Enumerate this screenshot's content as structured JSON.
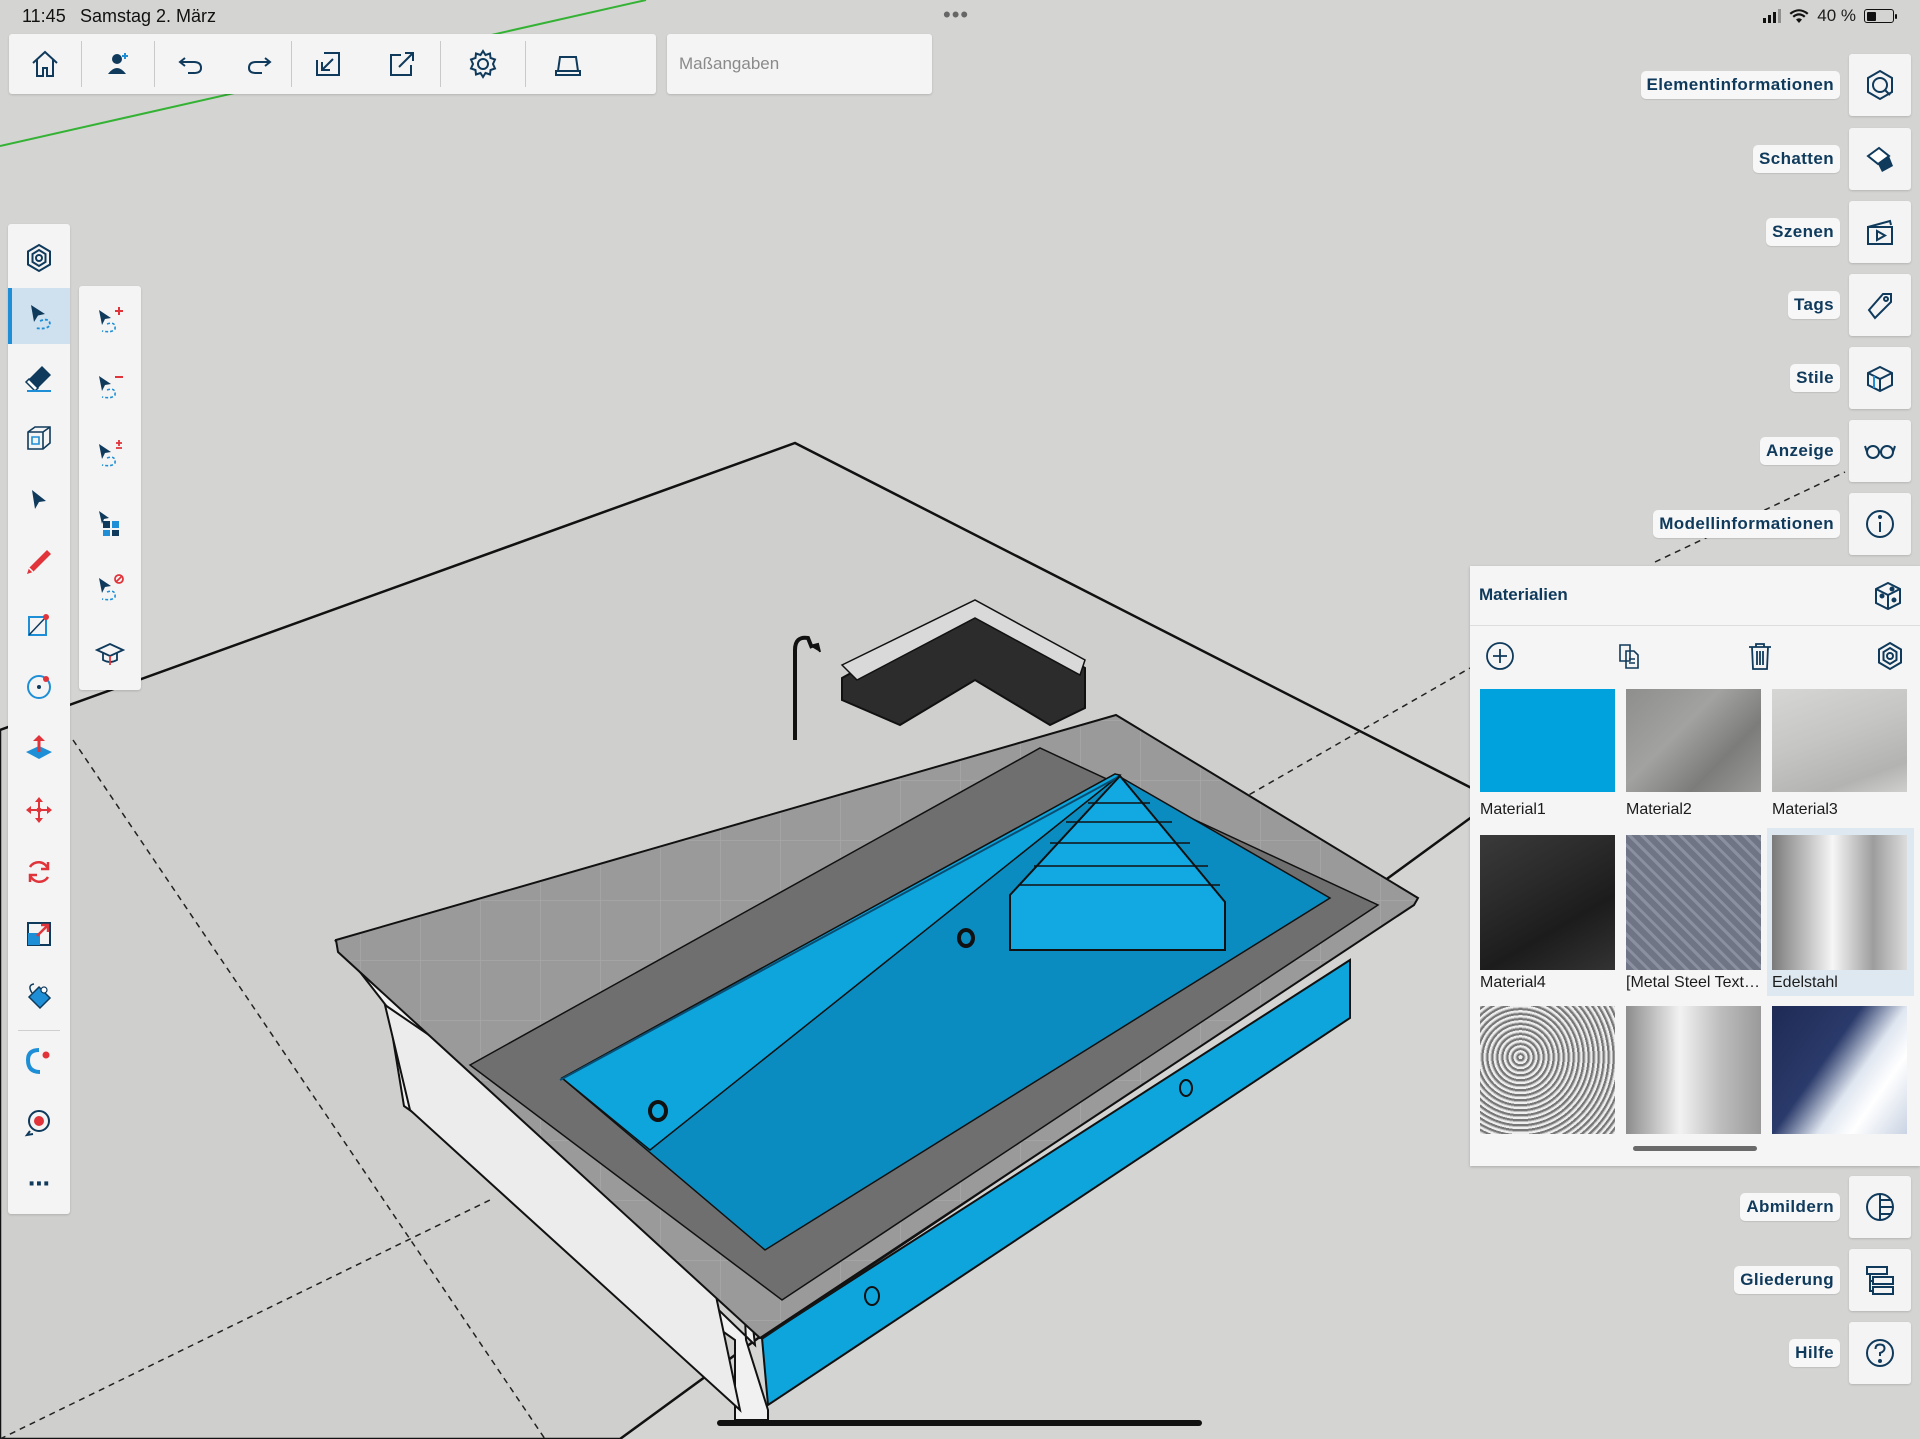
{
  "status_bar": {
    "time": "11:45",
    "date": "Samstag 2. März",
    "multitask_dots": "•••",
    "battery": "40 %",
    "battery_level": 0.4
  },
  "top_toolbar": {
    "icons": [
      "home-icon",
      "add-person-icon",
      "undo-icon",
      "redo-icon",
      "import-icon",
      "export-icon",
      "settings-icon",
      "pencil-case-icon"
    ],
    "measurements_placeholder": "Maßangaben"
  },
  "left_toolbar": {
    "active_tool": "select-tool",
    "tools": [
      "search-tool",
      "select-tool",
      "eraser-tool",
      "component-tool",
      "cursor-tool",
      "line-tool",
      "rectangle-tool",
      "circle-tool",
      "push-pull-tool",
      "move-tool",
      "rotate-tool",
      "scale-tool",
      "paint-bucket-tool",
      "follow-me-tool",
      "tape-measure-tool",
      "more-tool"
    ],
    "more_label": "⋯"
  },
  "sub_toolbar": {
    "tools": [
      "select-add-tool",
      "select-subtract-tool",
      "select-toggle-tool",
      "select-all-tool",
      "select-none-tool",
      "instructor-tool"
    ]
  },
  "right_panels": [
    {
      "label": "Elementinformationen",
      "icon": "entity-info-icon"
    },
    {
      "label": "Schatten",
      "icon": "shadow-icon"
    },
    {
      "label": "Szenen",
      "icon": "scenes-icon"
    },
    {
      "label": "Tags",
      "icon": "tag-icon"
    },
    {
      "label": "Stile",
      "icon": "styles-icon"
    },
    {
      "label": "Anzeige",
      "icon": "glasses-icon"
    },
    {
      "label": "Modellinformationen",
      "icon": "info-icon"
    },
    {
      "label": "Abmildern",
      "icon": "soften-icon"
    },
    {
      "label": "Gliederung",
      "icon": "outliner-icon"
    },
    {
      "label": "Hilfe",
      "icon": "help-icon"
    }
  ],
  "materials_panel": {
    "title": "Materialien",
    "tools": [
      "add-material-icon",
      "duplicate-material-icon",
      "delete-material-icon",
      "sample-material-icon"
    ],
    "materials": [
      {
        "name": "Material1",
        "swatch": "blue",
        "color": "#00a2dd"
      },
      {
        "name": "Material2",
        "swatch": "grey-stone",
        "color": "#8e8e8c"
      },
      {
        "name": "Material3",
        "swatch": "light-stone",
        "color": "#c5c5c3"
      },
      {
        "name": "Material4",
        "swatch": "dark-slate",
        "color": "#2b2b2b"
      },
      {
        "name": "[Metal Steel Text…",
        "swatch": "diamond-plate",
        "color": "#6f7584"
      },
      {
        "name": "Edelstahl",
        "swatch": "stainless",
        "color": "#c8c8c8",
        "selected": true
      },
      {
        "name": "",
        "swatch": "gravel",
        "color": "#777777"
      },
      {
        "name": "",
        "swatch": "brushed-metal",
        "color": "#bdbdbd"
      },
      {
        "name": "",
        "swatch": "sky",
        "color": "#2a3a6a"
      }
    ]
  }
}
